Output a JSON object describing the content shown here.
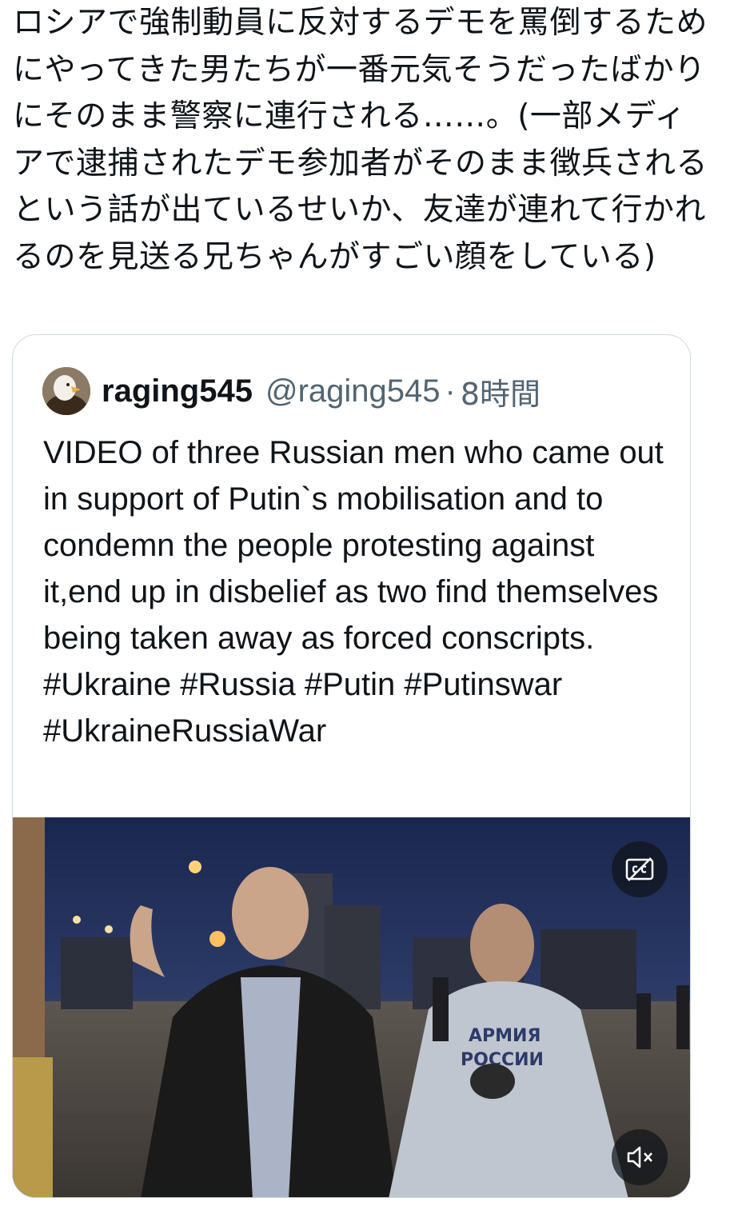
{
  "tweet": {
    "text": "ロシアで強制動員に反対するデモを罵倒するためにやってきた男たちが一番元気そうだったばかりにそのまま警察に連行される……。(一部メディアで逮捕されたデモ参加者がそのまま徴兵されるという話が出ているせいか、友達が連れて行かれるのを見送る兄ちゃんがすごい顔をしている)"
  },
  "quote": {
    "display_name": "raging545",
    "handle": "@raging545",
    "separator": "·",
    "timestamp": "8時間",
    "text": "VIDEO of three Russian men who came out in support of Putin`s mobilisation and to condemn the people protesting against it,end up in disbelief as two find themselves being taken away as forced conscripts. #Ukraine #Russia #Putin #Putinswar #UkraineRussiaWar",
    "media": {
      "hoodie_text_line1": "АРМИЯ",
      "hoodie_text_line2": "РОССИИ",
      "icons": [
        "cc-icon",
        "mute-icon"
      ]
    }
  },
  "colors": {
    "text": "#0f1419",
    "secondary": "#536471",
    "border": "#cfd9de",
    "sky": "#1c2a55"
  }
}
